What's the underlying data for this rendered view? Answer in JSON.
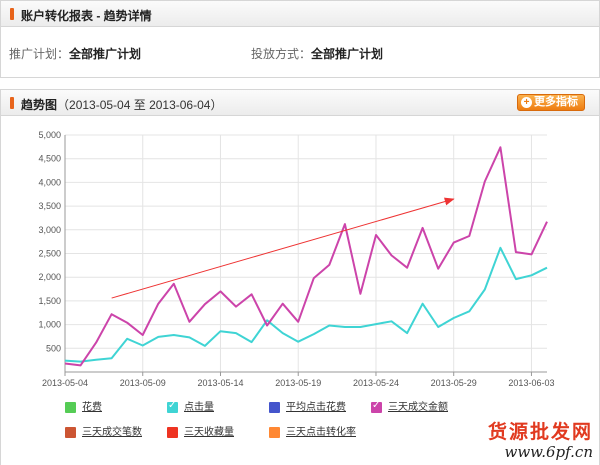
{
  "panel1": {
    "title": "账户转化报表 - 趋势详情",
    "plan_label": "推广计划：",
    "plan_value": "全部推广计划",
    "method_label": "投放方式：",
    "method_value": "全部推广计划"
  },
  "panel2": {
    "title": "趋势图",
    "date_range": "（2013-05-04 至 2013-06-04）",
    "more_button": "更多指标"
  },
  "chart_data": {
    "type": "line",
    "ylim": [
      0,
      5000
    ],
    "yticks": [
      "5,000",
      "4,500",
      "4,000",
      "3,500",
      "3,000",
      "2,500",
      "2,000",
      "1,500",
      "1,000",
      "500"
    ],
    "yticks_values": [
      5000,
      4500,
      4000,
      3500,
      3000,
      2500,
      2000,
      1500,
      1000,
      500
    ],
    "x": [
      "2013-05-04",
      "2013-05-05",
      "2013-05-06",
      "2013-05-07",
      "2013-05-08",
      "2013-05-09",
      "2013-05-10",
      "2013-05-11",
      "2013-05-12",
      "2013-05-13",
      "2013-05-14",
      "2013-05-15",
      "2013-05-16",
      "2013-05-17",
      "2013-05-18",
      "2013-05-19",
      "2013-05-20",
      "2013-05-21",
      "2013-05-22",
      "2013-05-23",
      "2013-05-24",
      "2013-05-25",
      "2013-05-26",
      "2013-05-27",
      "2013-05-28",
      "2013-05-29",
      "2013-05-30",
      "2013-05-31",
      "2013-06-01",
      "2013-06-02",
      "2013-06-03",
      "2013-06-04"
    ],
    "xtick_labels": [
      "2013-05-04",
      "2013-05-09",
      "2013-05-14",
      "2013-05-19",
      "2013-05-24",
      "2013-05-29",
      "2013-06-03"
    ],
    "series": [
      {
        "name": "点击量",
        "color": "#3fd4d4",
        "values": [
          240,
          220,
          260,
          290,
          700,
          560,
          740,
          780,
          730,
          550,
          860,
          820,
          630,
          1090,
          820,
          640,
          800,
          980,
          950,
          950,
          1010,
          1070,
          820,
          1440,
          950,
          1140,
          1280,
          1740,
          2620,
          1960,
          2040,
          2200
        ]
      },
      {
        "name": "三天成交金额",
        "color": "#cc44aa",
        "values": [
          180,
          140,
          620,
          1220,
          1040,
          780,
          1440,
          1860,
          1060,
          1430,
          1700,
          1380,
          1640,
          980,
          1440,
          1060,
          1980,
          2260,
          3120,
          1650,
          2890,
          2460,
          2200,
          3040,
          2180,
          2730,
          2870,
          4020,
          4740,
          2530,
          2480,
          3170
        ]
      }
    ],
    "annotation_arrow": {
      "from": [
        "2013-05-07",
        1560
      ],
      "to": [
        "2013-05-29",
        3650
      ],
      "color": "#ee3333"
    }
  },
  "legend": [
    {
      "label": "花费",
      "color": "#55cc55",
      "checked": false
    },
    {
      "label": "点击量",
      "color": "#3fd4d4",
      "checked": true
    },
    {
      "label": "平均点击花费",
      "color": "#4455cc",
      "checked": false
    },
    {
      "label": "三天成交金额",
      "color": "#cc44aa",
      "checked": true
    },
    {
      "label": "三天成交笔数",
      "color": "#cc5533",
      "checked": false
    },
    {
      "label": "三天收藏量",
      "color": "#ee3322",
      "checked": false
    },
    {
      "label": "三天点击转化率",
      "color": "#ff8833",
      "checked": false
    }
  ],
  "watermark": {
    "text": "货源批发网",
    "url": "www.6pf.cn"
  }
}
